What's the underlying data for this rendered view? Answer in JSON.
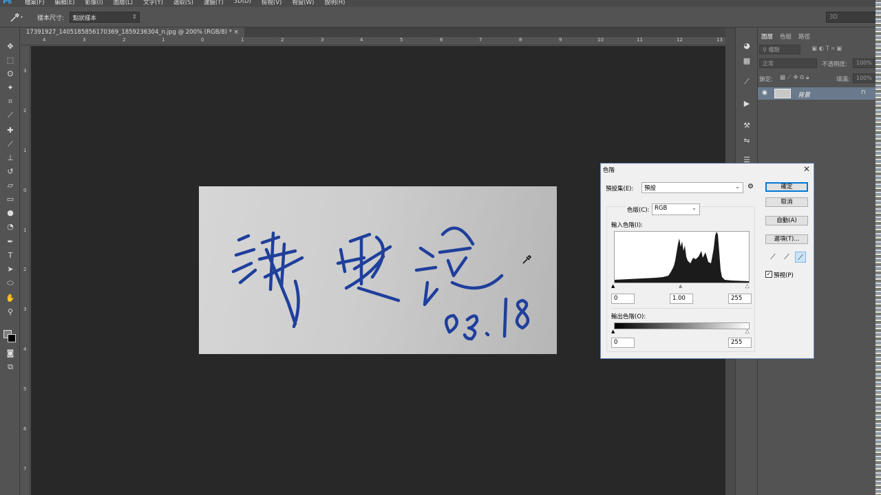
{
  "menubar": {
    "logo": "Ps",
    "items": [
      "檔案(F)",
      "編輯(E)",
      "影像(I)",
      "圖層(L)",
      "文字(Y)",
      "選取(S)",
      "濾鏡(T)",
      "3D(D)",
      "檢視(V)",
      "視窗(W)",
      "說明(H)"
    ]
  },
  "options": {
    "label": "樣本尺寸:",
    "sample_size": "點狀樣本",
    "workspace": "3D"
  },
  "document": {
    "tab_title": "17391927_1405185856170369_1859236304_n.jpg @ 200% (RGB/8) *",
    "ruler_top": [
      "4",
      "3",
      "2",
      "1",
      "0",
      "1",
      "2",
      "3",
      "4",
      "5",
      "6",
      "7",
      "8",
      "9",
      "10",
      "11",
      "12",
      "13"
    ],
    "ruler_left": [
      "3",
      "2",
      "1",
      "0",
      "1",
      "2",
      "3",
      "4",
      "5",
      "6",
      "7"
    ]
  },
  "layers_panel": {
    "tabs": [
      "圖層",
      "色版",
      "路徑"
    ],
    "filter": "種類",
    "blend_mode": "正常",
    "opacity_label": "不透明度:",
    "opacity_value": "100%",
    "lock_label": "鎖定:",
    "fill_label": "填滿:",
    "fill_value": "100%",
    "layer_name": "背景"
  },
  "levels_dialog": {
    "title": "色階",
    "preset_label": "預設集(E):",
    "preset_value": "預設",
    "channel_label": "色版(C):",
    "channel_value": "RGB",
    "input_levels_label": "輸入色階(I):",
    "input_black": "0",
    "input_gamma": "1.00",
    "input_white": "255",
    "output_levels_label": "輸出色階(O):",
    "output_black": "0",
    "output_white": "255",
    "ok": "確定",
    "cancel": "取消",
    "auto": "自動(A)",
    "options": "選項(T)...",
    "preview": "預視(P)",
    "preview_checked": true
  },
  "image": {
    "signature_date": "03.18",
    "ink_color": "#1f3f9c"
  }
}
